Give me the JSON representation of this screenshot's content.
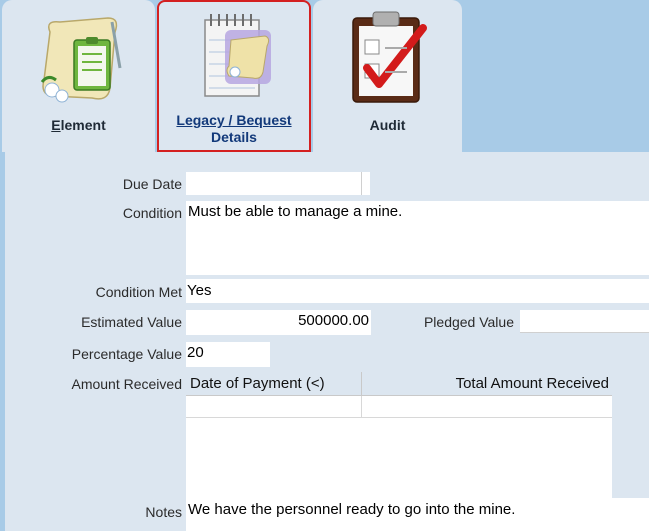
{
  "tabs": {
    "element": {
      "label_first": "E",
      "label_rest": "lement"
    },
    "legacy": {
      "line1": "Legacy / Bequest",
      "line2": "Details"
    },
    "audit": {
      "label": "Audit"
    }
  },
  "form": {
    "due_date": {
      "label": "Due Date",
      "value": ""
    },
    "condition": {
      "label": "Condition",
      "value": "Must be able to manage a mine."
    },
    "condition_met": {
      "label": "Condition Met",
      "value": "Yes"
    },
    "estimated_value": {
      "label": "Estimated Value",
      "value": "500000.00"
    },
    "pledged_value": {
      "label": "Pledged Value",
      "value": ""
    },
    "percentage_value": {
      "label": "Percentage Value",
      "value": "20"
    },
    "amount_received": {
      "label": "Amount Received",
      "columns": [
        "Date of Payment (<)",
        "Total Amount Received"
      ]
    },
    "notes": {
      "label": "Notes",
      "value": "We have the personnel ready to go into the mine."
    }
  }
}
